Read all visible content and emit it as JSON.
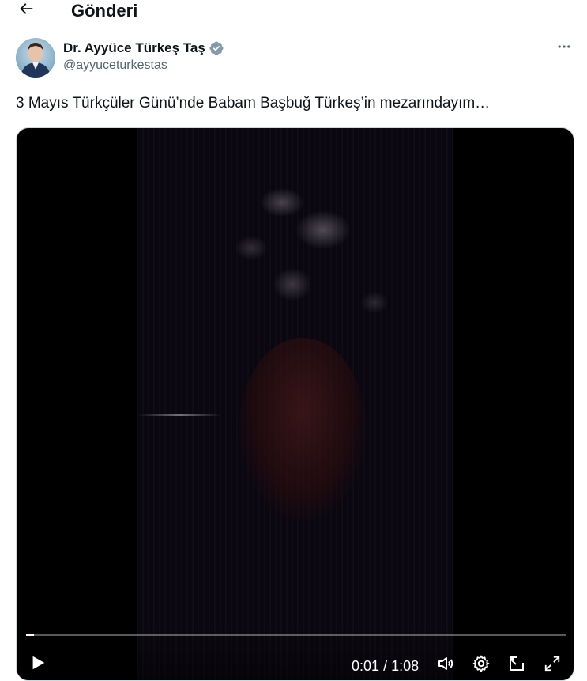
{
  "header": {
    "title": "Gönderi",
    "back_icon": "arrow-left-icon"
  },
  "author": {
    "name": "Dr. Ayyüce Türkeş Taş",
    "handle": "@ayyuceturkestas",
    "verified": true,
    "verified_color": "#829aab"
  },
  "post": {
    "text": "3 Mayıs Türkçüler Günü’nde Babam Başbuğ Türkeş’in mezarındayım…"
  },
  "video": {
    "current_time": "0:01",
    "separator": "/",
    "duration": "1:08",
    "progress_fraction": 0.015,
    "icons": [
      "play-icon",
      "volume-icon",
      "settings-icon",
      "pip-icon",
      "fullscreen-icon"
    ]
  },
  "colors": {
    "text": "#0f1419",
    "secondary": "#536471",
    "border": "#cfd9de"
  }
}
